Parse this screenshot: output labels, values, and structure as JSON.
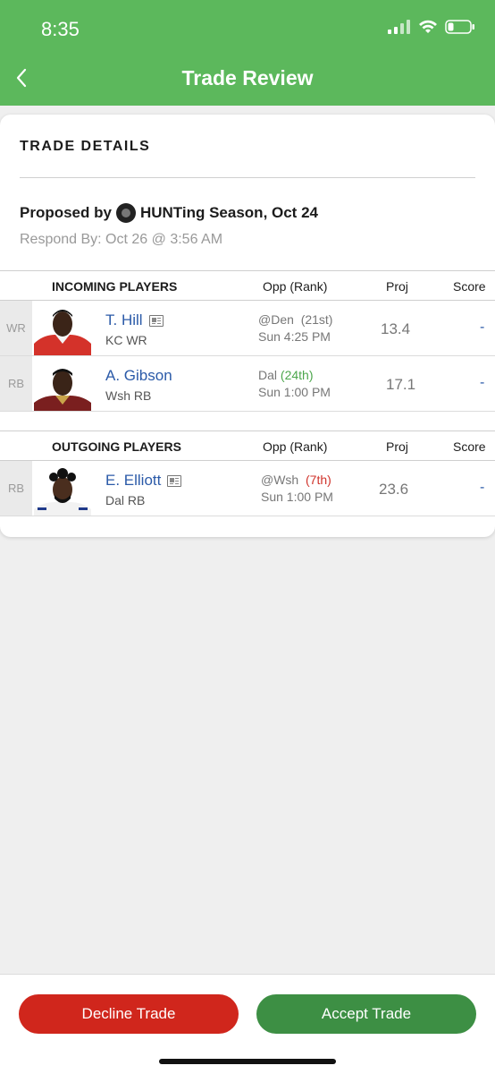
{
  "status": {
    "time": "8:35"
  },
  "header": {
    "title": "Trade Review"
  },
  "details": {
    "title": "TRADE DETAILS",
    "proposed_prefix": "Proposed by",
    "proposed_team": "HUNTing Season, Oct 24",
    "respond_by": "Respond By: Oct 26 @ 3:56 AM"
  },
  "columns": {
    "opp": "Opp (Rank)",
    "proj": "Proj",
    "score": "Score"
  },
  "incoming": {
    "title": "INCOMING PLAYERS",
    "players": [
      {
        "pos": "WR",
        "name": "T. Hill",
        "team": "KC WR",
        "opp": "@Den",
        "rank": "(21st)",
        "game": "Sun 4:25 PM",
        "proj": "13.4",
        "score": "-"
      },
      {
        "pos": "RB",
        "name": "A. Gibson",
        "team": "Wsh RB",
        "opp": "Dal",
        "rank": "(24th)",
        "game": "Sun 1:00 PM",
        "proj": "17.1",
        "score": "-"
      }
    ]
  },
  "outgoing": {
    "title": "OUTGOING PLAYERS",
    "players": [
      {
        "pos": "RB",
        "name": "E. Elliott",
        "team": "Dal RB",
        "opp": "@Wsh",
        "rank": "(7th)",
        "game": "Sun 1:00 PM",
        "proj": "23.6",
        "score": "-"
      }
    ]
  },
  "actions": {
    "decline": "Decline Trade",
    "accept": "Accept Trade"
  },
  "colors": {
    "header_green": "#5cb85c",
    "decline_red": "#d0261c",
    "accept_green": "#3d8f44",
    "link_blue": "#2b5aa8"
  }
}
